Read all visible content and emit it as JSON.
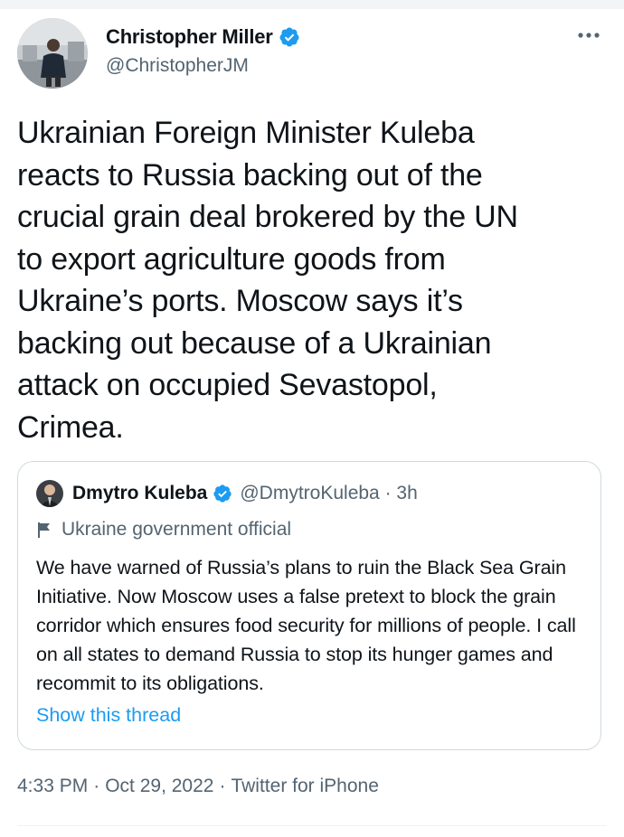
{
  "author": {
    "name": "Christopher Miller",
    "handle": "@ChristopherJM"
  },
  "tweet": {
    "text": "Ukrainian Foreign Minister Kuleba\nreacts to Russia backing out of the\ncrucial grain deal brokered by the UN\nto export agriculture goods from\nUkraine’s ports. Moscow says it’s\nbacking out because of a Ukrainian\nattack on occupied Sevastopol,\nCrimea."
  },
  "quote": {
    "name": "Dmytro Kuleba",
    "handle": "@DmytroKuleba · 3h",
    "label": "Ukraine government official",
    "text": "We have warned of Russia’s plans to ruin the Black Sea Grain Initiative. Now Moscow uses a false pretext to block the grain corridor which ensures food security for millions of people. I call on all states to demand Russia to stop its hunger games and recommit to its obligations.",
    "show_thread": "Show this thread"
  },
  "meta": {
    "time": "4:33 PM",
    "date": "Oct 29, 2022",
    "source": "Twitter for iPhone",
    "separator": "·"
  },
  "colors": {
    "text": "#0f1419",
    "secondary": "#536471",
    "accent": "#1d9bf0",
    "border": "#cfd9de"
  },
  "icons": {
    "verified": "verified-badge-icon",
    "more": "more-horizontal-icon",
    "flag": "government-flag-icon"
  }
}
